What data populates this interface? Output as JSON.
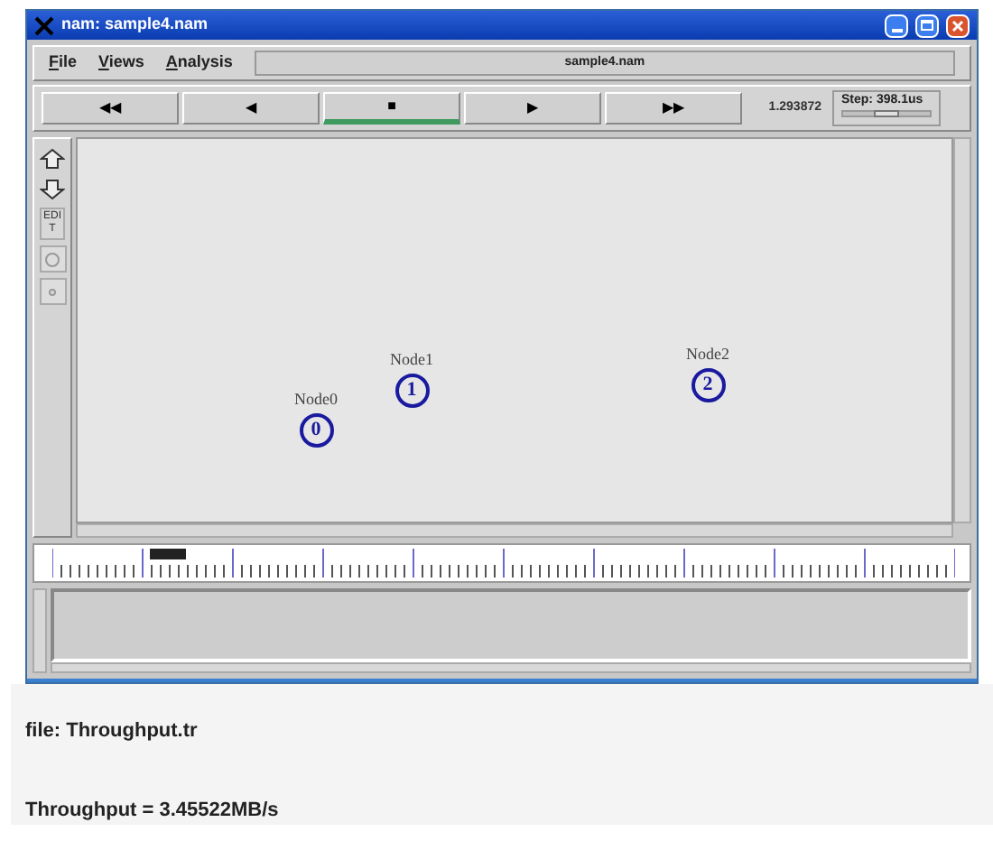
{
  "window": {
    "title": "nam: sample4.nam"
  },
  "menu": [
    {
      "label": "File"
    },
    {
      "label": "Views"
    },
    {
      "label": "Analysis"
    }
  ],
  "file_label": "sample4.nam",
  "controls": [
    {
      "label": "◀◀",
      "selected": false
    },
    {
      "label": "◀",
      "selected": false
    },
    {
      "label": "■",
      "selected": true
    },
    {
      "label": "▶",
      "selected": false
    },
    {
      "label": "▶▶",
      "selected": false
    }
  ],
  "time": "1.293872",
  "step": {
    "label": "Step: 398.1us",
    "level": 0.5
  },
  "toolbar": {
    "edit": "EDIT"
  },
  "nodes": [
    {
      "label": "Node0",
      "number": "0"
    },
    {
      "label": "Node1",
      "number": "1"
    },
    {
      "label": "Node2",
      "number": "2"
    }
  ],
  "caption": {
    "file": "file: Throughput.tr",
    "result": "Throughput = 3.45522MB/s"
  }
}
